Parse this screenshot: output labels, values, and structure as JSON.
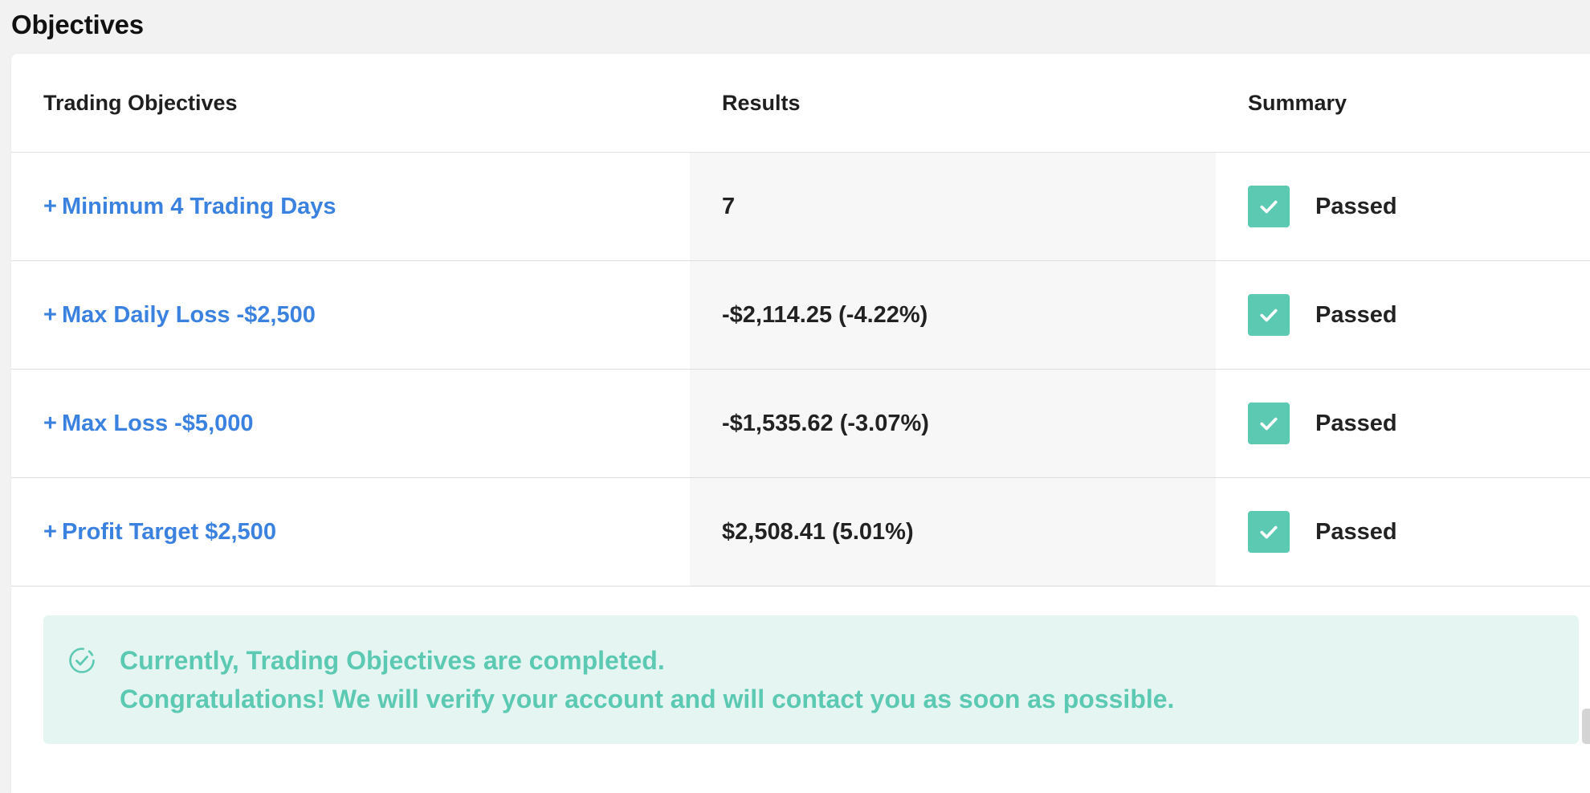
{
  "section": {
    "title": "Objectives"
  },
  "table": {
    "headers": {
      "objectives": "Trading Objectives",
      "results": "Results",
      "summary": "Summary"
    },
    "rows": [
      {
        "objective": "Minimum 4 Trading Days",
        "result": "7",
        "status": "Passed"
      },
      {
        "objective": "Max Daily Loss -$2,500",
        "result": "-$2,114.25 (-4.22%)",
        "status": "Passed"
      },
      {
        "objective": "Max Loss -$5,000",
        "result": "-$1,535.62 (-3.07%)",
        "status": "Passed"
      },
      {
        "objective": "Profit Target $2,500",
        "result": "$2,508.41 (5.01%)",
        "status": "Passed"
      }
    ],
    "expand_symbol": "+"
  },
  "notice": {
    "line1": "Currently, Trading Objectives are completed.",
    "line2": "Congratulations! We will verify your account and will contact you as soon as possible."
  },
  "icons": {
    "expand": "plus-icon",
    "passed": "check-icon",
    "notice": "circle-check-icon"
  },
  "colors": {
    "link": "#3b82e0",
    "success": "#5cc9b3",
    "notice_bg": "#e5f5f2"
  }
}
